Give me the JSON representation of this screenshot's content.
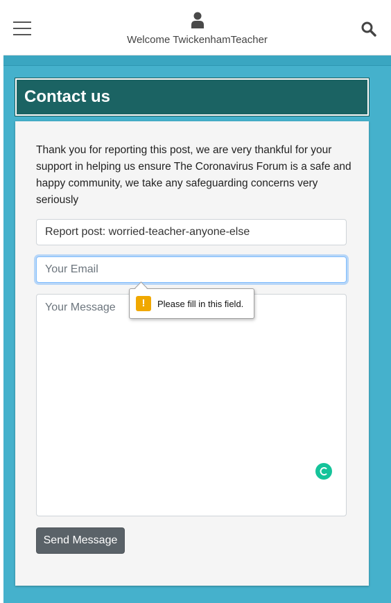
{
  "header": {
    "welcome_text": "Welcome TwickenhamTeacher",
    "menu_icon": "hamburger-menu-icon",
    "user_icon": "user-icon",
    "search_icon": "search-icon"
  },
  "contact": {
    "title": "Contact us",
    "intro": "Thank you for reporting this post, we are very thankful for your support in helping us ensure The Coronavirus Forum is a safe and happy community, we take any safeguarding concerns very seriously"
  },
  "form": {
    "report_value": "Report post: worried-teacher-anyone-else",
    "email_placeholder": "Your Email",
    "email_value": "",
    "message_placeholder": "Your Message",
    "message_value": "",
    "send_label": "Send Message"
  },
  "validation_tooltip": {
    "icon": "warning-icon",
    "text": "Please fill in this field."
  },
  "colors": {
    "page_background": "#45b1cc",
    "header_bar": "#1b6363",
    "button": "#5a6268",
    "focus_ring": "#80bdff",
    "warning": "#f0a800",
    "grammarly": "#15c39a"
  }
}
